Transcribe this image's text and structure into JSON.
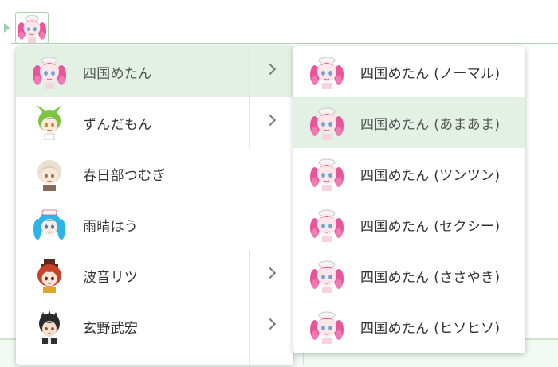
{
  "toolbar": {
    "character_icon": "shikoku-metan-avatar"
  },
  "main_menu": {
    "items": [
      {
        "label": "四国めたん",
        "avatar": "pink-twin-drill-girl",
        "has_submenu": true,
        "active": true
      },
      {
        "label": "ずんだもん",
        "avatar": "green-hair-girl",
        "has_submenu": true,
        "active": false
      },
      {
        "label": "春日部つむぎ",
        "avatar": "blonde-girl",
        "has_submenu": false,
        "active": false
      },
      {
        "label": "雨晴はう",
        "avatar": "blue-hair-nurse",
        "has_submenu": false,
        "active": false
      },
      {
        "label": "波音リツ",
        "avatar": "red-hair-girl",
        "has_submenu": true,
        "active": false
      },
      {
        "label": "玄野武宏",
        "avatar": "dark-hair-boy",
        "has_submenu": true,
        "active": false
      }
    ]
  },
  "sub_menu": {
    "items": [
      {
        "label": "四国めたん (ノーマル)",
        "active": false
      },
      {
        "label": "四国めたん (あまあま)",
        "active": true
      },
      {
        "label": "四国めたん (ツンツン)",
        "active": false
      },
      {
        "label": "四国めたん (セクシー)",
        "active": false
      },
      {
        "label": "四国めたん (ささやき)",
        "active": false
      },
      {
        "label": "四国めたん (ヒソヒソ)",
        "active": false
      }
    ]
  },
  "colors": {
    "accent": "#a8d6b0",
    "active_bg": "#e2f1e4",
    "pink": "#e8559a"
  }
}
